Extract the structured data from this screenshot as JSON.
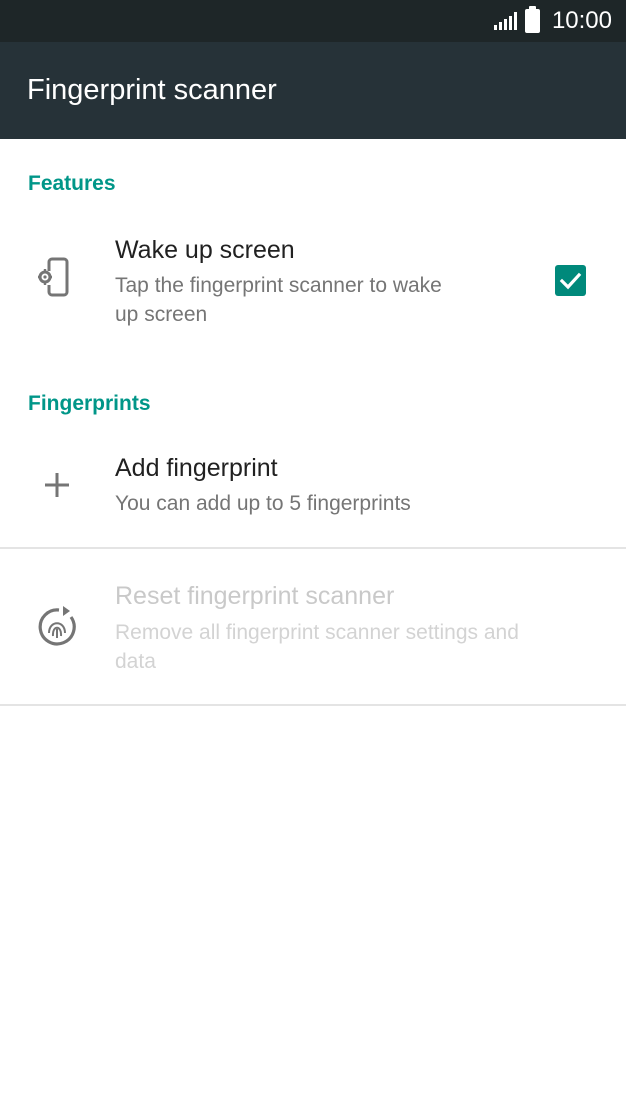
{
  "status_bar": {
    "time": "10:00"
  },
  "app_bar": {
    "title": "Fingerprint scanner"
  },
  "sections": {
    "features": {
      "header": "Features"
    },
    "fingerprints": {
      "header": "Fingerprints"
    }
  },
  "items": {
    "wake_up": {
      "title": "Wake up screen",
      "summary_line1": "Tap the fingerprint scanner to wake",
      "summary_line2": "up screen",
      "checked": true,
      "icon": "phone-settings-icon"
    },
    "add_fingerprint": {
      "title": "Add fingerprint",
      "summary": "You can add up to 5 fingerprints",
      "icon": "plus-icon"
    },
    "reset": {
      "title": "Reset fingerprint scanner",
      "summary_line1": "Remove all fingerprint scanner settings and",
      "summary_line2": "data",
      "enabled": false,
      "icon": "fingerprint-reset-icon"
    }
  },
  "colors": {
    "accent": "#009688",
    "app_bar": "#263238",
    "status_bar": "#1e2628"
  }
}
